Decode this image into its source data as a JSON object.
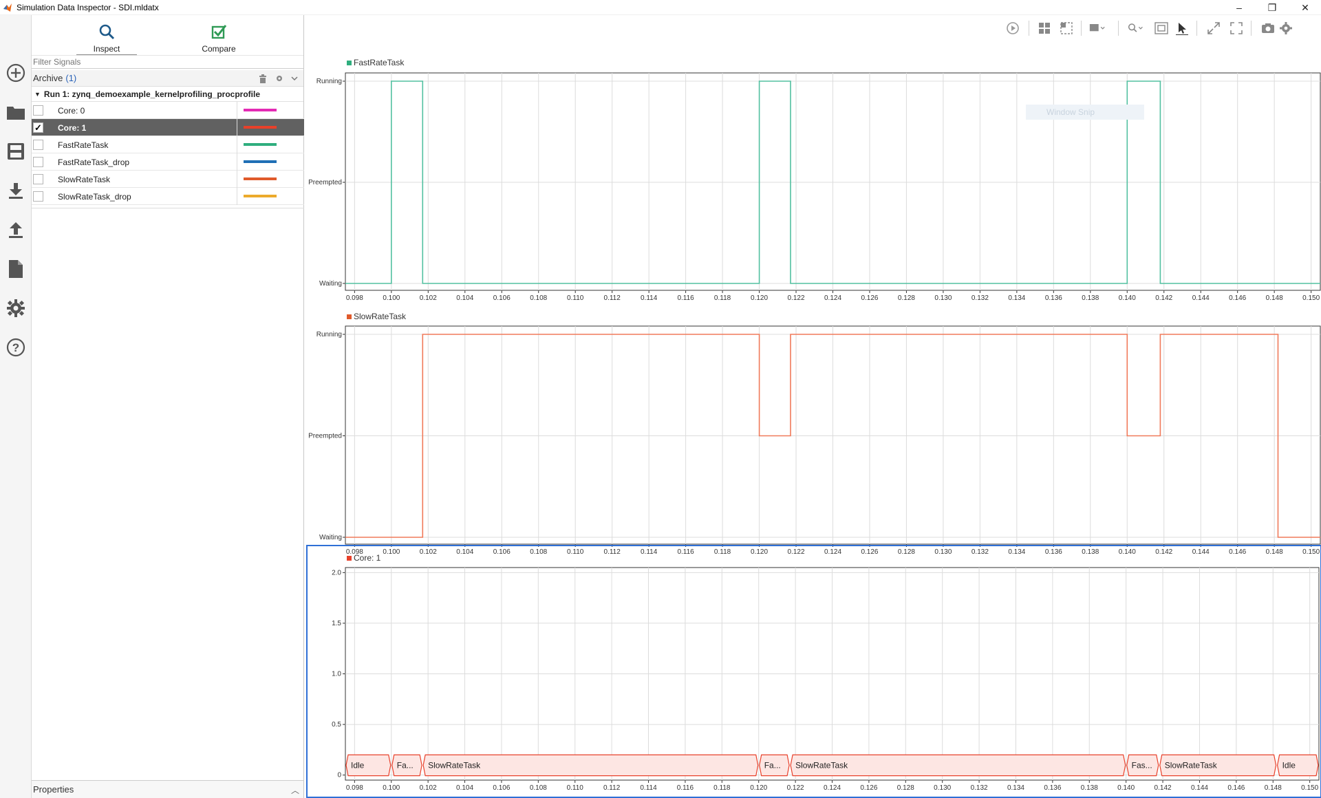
{
  "window": {
    "title": "Simulation Data Inspector - SDI.mldatx",
    "controls": [
      "–",
      "❐",
      "✕"
    ]
  },
  "rail": {
    "icons": [
      "add-icon",
      "folder-icon",
      "save-icon",
      "download-icon",
      "upload-icon",
      "document-icon",
      "settings-icon",
      "help-icon"
    ]
  },
  "modes": {
    "inspect": "Inspect",
    "compare": "Compare"
  },
  "filter": {
    "placeholder": "Filter Signals"
  },
  "archive": {
    "label": "Archive",
    "count": "(1)"
  },
  "run": {
    "label": "Run 1: zynq_demoexample_kernelprofiling_procprofile"
  },
  "signals": [
    {
      "label": "Core: 0",
      "color": "#e32bb4",
      "checked": false,
      "selected": false
    },
    {
      "label": "Core: 1",
      "color": "#e8402a",
      "checked": true,
      "selected": true
    },
    {
      "label": "FastRateTask",
      "color": "#2fae7e",
      "checked": false,
      "selected": false
    },
    {
      "label": "FastRateTask_drop",
      "color": "#1f6fb5",
      "checked": false,
      "selected": false
    },
    {
      "label": "SlowRateTask",
      "color": "#e05a2b",
      "checked": false,
      "selected": false
    },
    {
      "label": "SlowRateTask_drop",
      "color": "#ecaa2c",
      "checked": false,
      "selected": false
    }
  ],
  "properties": {
    "label": "Properties"
  },
  "ghost_text": "Window Snip",
  "x_ticks": [
    "0.098",
    "0.100",
    "0.102",
    "0.104",
    "0.106",
    "0.108",
    "0.110",
    "0.112",
    "0.114",
    "0.116",
    "0.118",
    "0.120",
    "0.122",
    "0.124",
    "0.126",
    "0.128",
    "0.130",
    "0.132",
    "0.134",
    "0.136",
    "0.138",
    "0.140",
    "0.142",
    "0.144",
    "0.146",
    "0.148",
    "0.150"
  ],
  "chart_data": [
    {
      "type": "line",
      "title": "FastRateTask",
      "color": "#52c0a0",
      "legend_color": "#2fae7e",
      "y_categories": [
        "Waiting",
        "Preempted",
        "Running"
      ],
      "xlim": [
        0.0975,
        0.1505
      ],
      "x": [
        0.0975,
        0.1,
        0.1,
        0.1017,
        0.1017,
        0.12,
        0.12,
        0.1217,
        0.1217,
        0.14,
        0.14,
        0.1418,
        0.1418,
        0.1505
      ],
      "y": [
        "Waiting",
        "Waiting",
        "Running",
        "Running",
        "Waiting",
        "Waiting",
        "Running",
        "Running",
        "Waiting",
        "Waiting",
        "Running",
        "Running",
        "Waiting",
        "Waiting"
      ]
    },
    {
      "type": "line",
      "title": "SlowRateTask",
      "color": "#f07a5a",
      "legend_color": "#e05a2b",
      "y_categories": [
        "Waiting",
        "Preempted",
        "Running"
      ],
      "xlim": [
        0.0975,
        0.1505
      ],
      "x": [
        0.0975,
        0.1017,
        0.1017,
        0.12,
        0.12,
        0.1217,
        0.1217,
        0.14,
        0.14,
        0.1418,
        0.1418,
        0.1482,
        0.1482,
        0.1505
      ],
      "y": [
        "Waiting",
        "Waiting",
        "Running",
        "Running",
        "Preempted",
        "Preempted",
        "Running",
        "Running",
        "Preempted",
        "Preempted",
        "Running",
        "Running",
        "Waiting",
        "Waiting"
      ]
    },
    {
      "type": "state_band",
      "title": "Core: 1",
      "color": "#e8402a",
      "legend_color": "#e8402a",
      "xlim": [
        0.0975,
        0.1505
      ],
      "ylim": [
        -0.05,
        2.05
      ],
      "y_ticks": [
        "0",
        "0.5",
        "1.0",
        "1.5",
        "2.0"
      ],
      "y_tick_values": [
        0,
        0.5,
        1.0,
        1.5,
        2.0
      ],
      "segments": [
        {
          "start": 0.0975,
          "end": 0.1,
          "label": "Idle"
        },
        {
          "start": 0.1,
          "end": 0.1017,
          "label": "Fa..."
        },
        {
          "start": 0.1017,
          "end": 0.12,
          "label": "SlowRateTask"
        },
        {
          "start": 0.12,
          "end": 0.1217,
          "label": "Fa..."
        },
        {
          "start": 0.1217,
          "end": 0.14,
          "label": "SlowRateTask"
        },
        {
          "start": 0.14,
          "end": 0.1418,
          "label": "Fas..."
        },
        {
          "start": 0.1418,
          "end": 0.1482,
          "label": "SlowRateTask"
        },
        {
          "start": 0.1482,
          "end": 0.1505,
          "label": "Idle"
        }
      ]
    }
  ]
}
